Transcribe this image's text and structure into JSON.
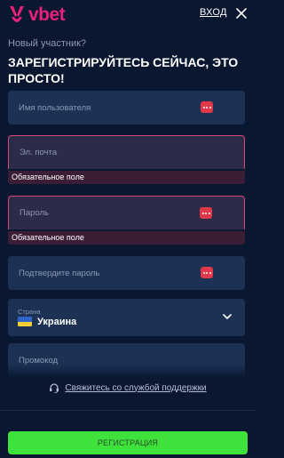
{
  "header": {
    "brand": "vbet",
    "login_label": "ВХОД"
  },
  "intro": {
    "subtitle": "Новый участник?",
    "title": "ЗАРЕГИСТРИРУЙТЕСЬ СЕЙЧАС, ЭТО ПРОСТО!"
  },
  "form": {
    "username": {
      "placeholder": "Имя пользователя",
      "value": ""
    },
    "email": {
      "placeholder": "Эл. почта",
      "value": "",
      "error": "Обязательное поле"
    },
    "password": {
      "placeholder": "Пароль",
      "value": "",
      "error": "Обязательное поле"
    },
    "confirm_password": {
      "placeholder": "Подтвердите пароль",
      "value": ""
    },
    "country": {
      "label": "Страна",
      "value": "Украина"
    },
    "promo": {
      "placeholder": "Промокод",
      "value": ""
    }
  },
  "support": {
    "label": "Свяжитесь со службой поддержки"
  },
  "submit": {
    "label": "РЕГИСТРАЦИЯ"
  },
  "colors": {
    "background": "#0a1730",
    "field": "#1d3155",
    "brand": "#e8217a",
    "error_border": "#d9477a",
    "submit": "#3ee23a"
  },
  "icons": {
    "close": "close-icon",
    "password_manager": "dots-icon",
    "chevron": "chevron-down-icon",
    "support": "headset-icon"
  }
}
